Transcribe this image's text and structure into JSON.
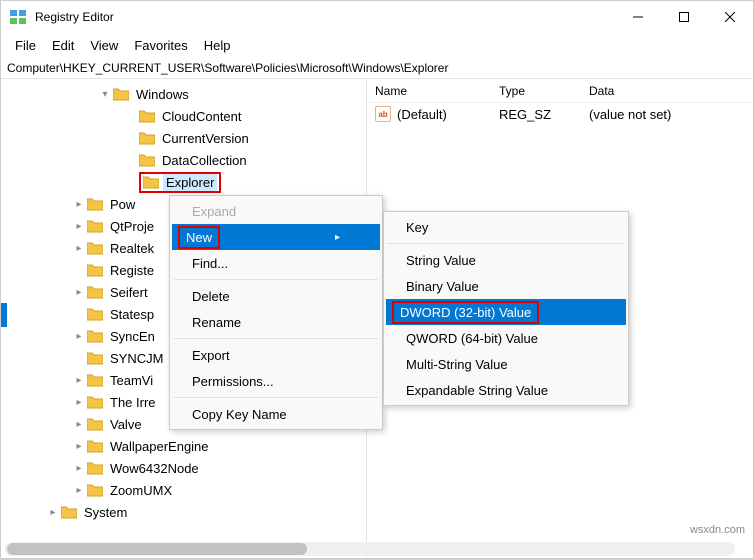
{
  "title": "Registry Editor",
  "menubar": {
    "file": "File",
    "edit": "Edit",
    "view": "View",
    "favorites": "Favorites",
    "help": "Help"
  },
  "address": "Computer\\HKEY_CURRENT_USER\\Software\\Policies\\Microsoft\\Windows\\Explorer",
  "tree": {
    "windows": "Windows",
    "cloudcontent": "CloudContent",
    "currentversion": "CurrentVersion",
    "datacollection": "DataCollection",
    "explorer": "Explorer",
    "pow": "Pow",
    "qtproject": "QtProje",
    "realtek": "Realtek",
    "registe": "Registe",
    "seifert": "Seifert",
    "statesp": "Statesp",
    "synceng": "SyncEn",
    "syncjm": "SYNCJM",
    "teamvi": "TeamVi",
    "theirre": "The Irre",
    "valve": "Valve",
    "wallpaperengine": "WallpaperEngine",
    "wow6432node": "Wow6432Node",
    "zoomumx": "ZoomUMX",
    "system": "System"
  },
  "list": {
    "hdr_name": "Name",
    "hdr_type": "Type",
    "hdr_data": "Data",
    "row_name": "(Default)",
    "row_type": "REG_SZ",
    "row_data": "(value not set)",
    "valicon": "ab"
  },
  "ctx": {
    "expand": "Expand",
    "new": "New",
    "find": "Find...",
    "delete": "Delete",
    "rename": "Rename",
    "export": "Export",
    "permissions": "Permissions...",
    "copykeyname": "Copy Key Name"
  },
  "submenu": {
    "key": "Key",
    "string": "String Value",
    "binary": "Binary Value",
    "dword": "DWORD (32-bit) Value",
    "qword": "QWORD (64-bit) Value",
    "multistring": "Multi-String Value",
    "expandable": "Expandable String Value"
  },
  "watermark": "wsxdn.com"
}
